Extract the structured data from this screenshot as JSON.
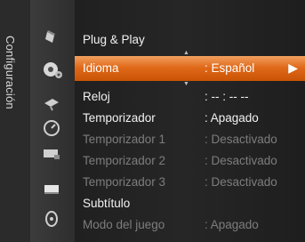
{
  "sidebar": {
    "title": "Configuración"
  },
  "icons": [
    {
      "name": "picture-icon"
    },
    {
      "name": "setup-icon"
    },
    {
      "name": "satellite-icon"
    },
    {
      "name": "clock-icon"
    },
    {
      "name": "input-icon"
    },
    {
      "name": "screen-icon"
    },
    {
      "name": "support-icon"
    }
  ],
  "menu": {
    "items": [
      {
        "label": "Plug & Play",
        "value": ""
      },
      {
        "label": "Idioma",
        "value": ": Español"
      },
      {
        "label": "Reloj",
        "value": ": -- : -- --"
      },
      {
        "label": "Temporizador",
        "value": ": Apagado"
      },
      {
        "label": "Temporizador 1",
        "value": ": Desactivado"
      },
      {
        "label": "Temporizador 2",
        "value": ": Desactivado"
      },
      {
        "label": "Temporizador 3",
        "value": ": Desactivado"
      },
      {
        "label": "Subtítulo",
        "value": ""
      },
      {
        "label": "Modo del juego",
        "value": ": Apagado"
      }
    ],
    "selected_arrow": "▶",
    "up_arrow": "▲",
    "down_arrow": "▼"
  },
  "colors": {
    "highlight": "#e06a1a",
    "dim_text": "#7d7d7d"
  }
}
